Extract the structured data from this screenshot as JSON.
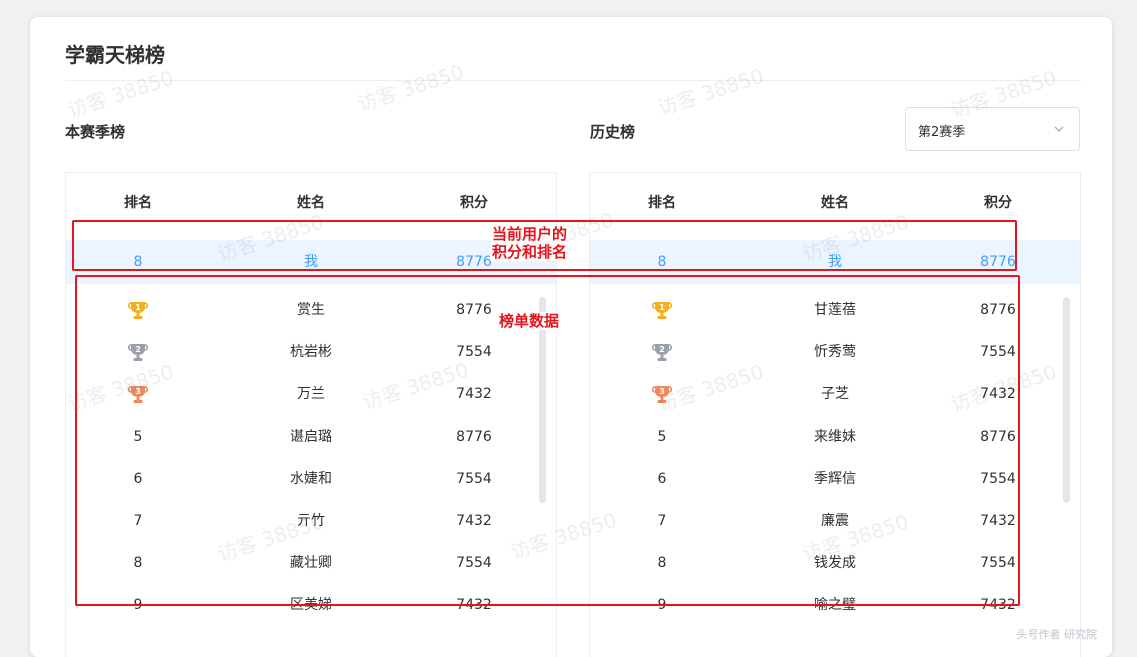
{
  "card": {
    "title": "学霸天梯榜"
  },
  "current": {
    "title": "本赛季榜",
    "columns": [
      "排名",
      "姓名",
      "积分"
    ],
    "me": {
      "rank": "8",
      "name": "我",
      "score": "8776"
    },
    "rows": [
      {
        "rank": "1",
        "trophy": "gold",
        "name": "赏生",
        "score": "8776"
      },
      {
        "rank": "2",
        "trophy": "silver",
        "name": "杭岩彬",
        "score": "7554"
      },
      {
        "rank": "3",
        "trophy": "bronze",
        "name": "万兰",
        "score": "7432"
      },
      {
        "rank": "5",
        "trophy": "",
        "name": "谌启璐",
        "score": "8776"
      },
      {
        "rank": "6",
        "trophy": "",
        "name": "水婕和",
        "score": "7554"
      },
      {
        "rank": "7",
        "trophy": "",
        "name": "亓竹",
        "score": "7432"
      },
      {
        "rank": "8",
        "trophy": "",
        "name": "藏壮卿",
        "score": "7554"
      },
      {
        "rank": "9",
        "trophy": "",
        "name": "区美娣",
        "score": "7432"
      }
    ]
  },
  "history": {
    "title": "历史榜",
    "select_value": "第2赛季",
    "columns": [
      "排名",
      "姓名",
      "积分"
    ],
    "me": {
      "rank": "8",
      "name": "我",
      "score": "8776"
    },
    "rows": [
      {
        "rank": "1",
        "trophy": "gold",
        "name": "甘莲蓓",
        "score": "8776"
      },
      {
        "rank": "2",
        "trophy": "silver",
        "name": "忻秀莺",
        "score": "7554"
      },
      {
        "rank": "3",
        "trophy": "bronze",
        "name": "子芝",
        "score": "7432"
      },
      {
        "rank": "5",
        "trophy": "",
        "name": "来维妹",
        "score": "8776"
      },
      {
        "rank": "6",
        "trophy": "",
        "name": "季辉信",
        "score": "7554"
      },
      {
        "rank": "7",
        "trophy": "",
        "name": "廉震",
        "score": "7432"
      },
      {
        "rank": "8",
        "trophy": "",
        "name": "钱发成",
        "score": "7554"
      },
      {
        "rank": "9",
        "trophy": "",
        "name": "喻之璧",
        "score": "7432"
      }
    ]
  },
  "annotations": {
    "me_row_label_line1": "当前用户的",
    "me_row_label_line2": "积分和排名",
    "list_label": "榜单数据"
  },
  "watermark": {
    "text": "访客 38850"
  },
  "footer_watermark": "头号作者 研究院",
  "colors": {
    "accent": "#409eff",
    "me_row_bg": "#ecf5ff",
    "annotation": "#e5141d",
    "gold": "#f2b01e",
    "silver": "#9aa0a8",
    "bronze": "#f08a5d"
  }
}
